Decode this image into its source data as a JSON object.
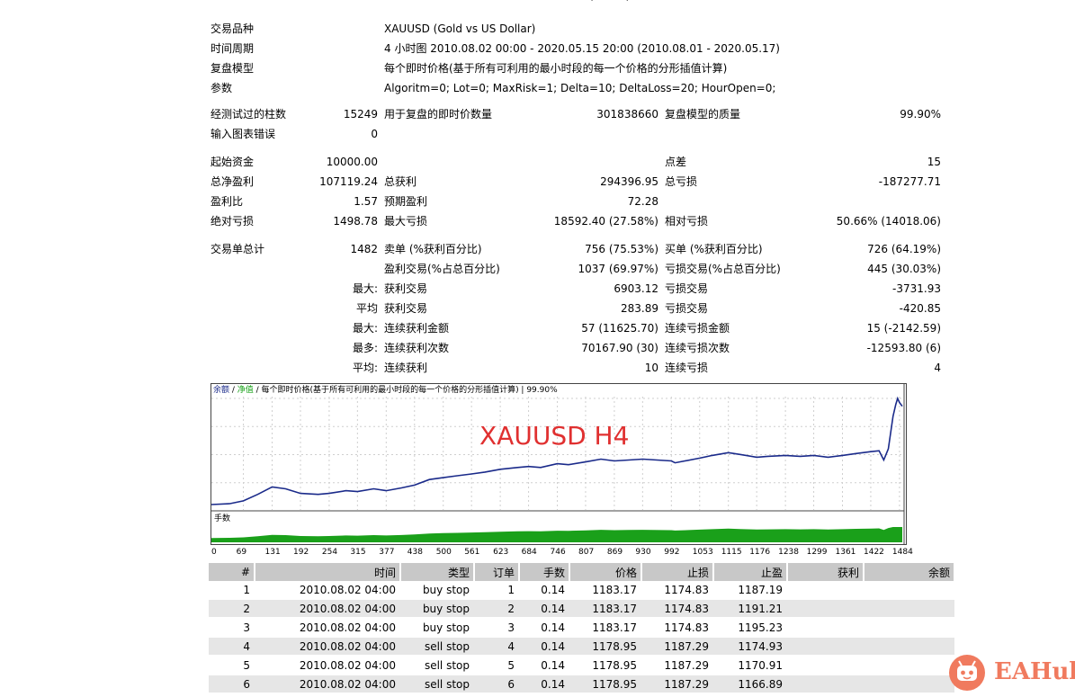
{
  "header_tail": "(………)",
  "info": [
    {
      "label": "交易品种",
      "value": "XAUUSD (Gold vs US Dollar)"
    },
    {
      "label": "时间周期",
      "value": "4 小时图 2010.08.02 00:00 - 2020.05.15 20:00 (2010.08.01 - 2020.05.17)"
    },
    {
      "label": "复盘模型",
      "value": "每个即时价格(基于所有可利用的最小时段的每一个价格的分形插值计算)"
    },
    {
      "label": "参数",
      "value": "Algoritm=0; Lot=0; MaxRisk=1; Delta=10; DeltaLoss=20; HourOpen=0;"
    }
  ],
  "stats": {
    "bars_label": "经测试过的柱数",
    "bars_value": "15249",
    "ticks_label": "用于复盘的即时价数量",
    "ticks_value": "301838660",
    "quality_label": "复盘模型的质量",
    "quality_value": "99.90%",
    "errors_label": "输入图表错误",
    "errors_value": "0",
    "deposit_label": "起始资金",
    "deposit_value": "10000.00",
    "spread_label": "点差",
    "spread_value": "15",
    "net_label": "总净盈利",
    "net_value": "107119.24",
    "gross_profit_label": "总获利",
    "gross_profit_value": "294396.95",
    "gross_loss_label": "总亏损",
    "gross_loss_value": "-187277.71",
    "pf_label": "盈利比",
    "pf_value": "1.57",
    "expected_label": "预期盈利",
    "expected_value": "72.28",
    "abs_dd_label": "绝对亏损",
    "abs_dd_value": "1498.78",
    "max_dd_label": "最大亏损",
    "max_dd_value": "18592.40 (27.58%)",
    "rel_dd_label": "相对亏损",
    "rel_dd_value": "50.66% (14018.06)",
    "total_trades_label": "交易单总计",
    "total_trades_value": "1482",
    "short_label": "卖单 (%获利百分比)",
    "short_value": "756 (75.53%)",
    "long_label": "买单 (%获利百分比)",
    "long_value": "726 (64.19%)",
    "profit_trades_label": "盈利交易(%占总百分比)",
    "profit_trades_value": "1037 (69.97%)",
    "loss_trades_label": "亏损交易(%占总百分比)",
    "loss_trades_value": "445 (30.03%)",
    "largest_prefix": "最大:",
    "largest_profit_label": "获利交易",
    "largest_profit_value": "6903.12",
    "largest_loss_label": "亏损交易",
    "largest_loss_value": "-3731.93",
    "average_prefix": "平均",
    "average_profit_label": "获利交易",
    "average_profit_value": "283.89",
    "average_loss_label": "亏损交易",
    "average_loss_value": "-420.85",
    "max_cons_prefix": "最大:",
    "max_cons_wins_label": "连续获利金额",
    "max_cons_wins_value": "57 (11625.70)",
    "max_cons_losses_label": "连续亏损金额",
    "max_cons_losses_value": "15 (-2142.59)",
    "maximal_prefix": "最多:",
    "maximal_wins_label": "连续获利次数",
    "maximal_wins_value": "70167.90 (30)",
    "maximal_losses_label": "连续亏损次数",
    "maximal_losses_value": "-12593.80 (6)",
    "avg_cons_prefix": "平均:",
    "avg_cons_wins_label": "连续获利",
    "avg_cons_wins_value": "10",
    "avg_cons_losses_label": "连续亏损",
    "avg_cons_losses_value": "4"
  },
  "chart": {
    "caption_balance": "余额",
    "caption_sep1": " / ",
    "caption_equity": "净值",
    "caption_rest": " / 每个即时价格(基于所有可利用的最小时段的每一个价格的分形插值计算) | 99.90%",
    "overlay_title": "XAUUSD H4",
    "volume_label": "手数",
    "balance_color": "#1a2a8a",
    "volume_color": "#1aa01a"
  },
  "chart_data": {
    "type": "line",
    "series": [
      {
        "name": "余额"
      }
    ],
    "x_ticks": [
      0,
      69,
      131,
      192,
      254,
      315,
      377,
      438,
      500,
      561,
      623,
      684,
      746,
      807,
      869,
      930,
      992,
      1053,
      1115,
      1176,
      1238,
      1299,
      1361,
      1422,
      1484
    ],
    "y_ticks": [
      124417,
      94122,
      63827,
      33533,
      3238
    ],
    "balance_points": [
      [
        0,
        10000
      ],
      [
        40,
        11000
      ],
      [
        69,
        14000
      ],
      [
        100,
        21000
      ],
      [
        131,
        29000
      ],
      [
        160,
        27000
      ],
      [
        192,
        22000
      ],
      [
        230,
        21000
      ],
      [
        254,
        22000
      ],
      [
        290,
        25000
      ],
      [
        315,
        24000
      ],
      [
        350,
        27000
      ],
      [
        377,
        25000
      ],
      [
        410,
        28000
      ],
      [
        438,
        31000
      ],
      [
        470,
        37000
      ],
      [
        500,
        39000
      ],
      [
        530,
        41000
      ],
      [
        561,
        43000
      ],
      [
        590,
        45000
      ],
      [
        623,
        48000
      ],
      [
        660,
        50000
      ],
      [
        684,
        51000
      ],
      [
        710,
        50000
      ],
      [
        746,
        54000
      ],
      [
        770,
        53000
      ],
      [
        807,
        56000
      ],
      [
        840,
        59000
      ],
      [
        869,
        57000
      ],
      [
        900,
        58000
      ],
      [
        930,
        59000
      ],
      [
        992,
        57000
      ],
      [
        1000,
        55000
      ],
      [
        1053,
        60000
      ],
      [
        1080,
        63000
      ],
      [
        1115,
        66000
      ],
      [
        1140,
        64000
      ],
      [
        1176,
        61000
      ],
      [
        1200,
        62000
      ],
      [
        1238,
        63000
      ],
      [
        1270,
        62000
      ],
      [
        1299,
        63000
      ],
      [
        1330,
        61000
      ],
      [
        1361,
        63000
      ],
      [
        1390,
        65000
      ],
      [
        1422,
        67000
      ],
      [
        1440,
        68000
      ],
      [
        1450,
        58000
      ],
      [
        1460,
        70000
      ],
      [
        1470,
        105000
      ],
      [
        1476,
        118000
      ],
      [
        1480,
        124417
      ],
      [
        1484,
        120000
      ],
      [
        1490,
        116000
      ]
    ],
    "x_range": [
      0,
      1490
    ],
    "y_range": [
      3238,
      124417
    ]
  },
  "orders": {
    "headers": [
      "#",
      "时间",
      "类型",
      "订单",
      "手数",
      "价格",
      "止损",
      "止盈",
      "获利",
      "余额"
    ],
    "rows": [
      [
        "1",
        "2010.08.02 04:00",
        "buy stop",
        "1",
        "0.14",
        "1183.17",
        "1174.83",
        "1187.19",
        "",
        ""
      ],
      [
        "2",
        "2010.08.02 04:00",
        "buy stop",
        "2",
        "0.14",
        "1183.17",
        "1174.83",
        "1191.21",
        "",
        ""
      ],
      [
        "3",
        "2010.08.02 04:00",
        "buy stop",
        "3",
        "0.14",
        "1183.17",
        "1174.83",
        "1195.23",
        "",
        ""
      ],
      [
        "4",
        "2010.08.02 04:00",
        "sell stop",
        "4",
        "0.14",
        "1178.95",
        "1187.29",
        "1174.93",
        "",
        ""
      ],
      [
        "5",
        "2010.08.02 04:00",
        "sell stop",
        "5",
        "0.14",
        "1178.95",
        "1187.29",
        "1170.91",
        "",
        ""
      ],
      [
        "6",
        "2010.08.02 04:00",
        "sell stop",
        "6",
        "0.14",
        "1178.95",
        "1187.29",
        "1166.89",
        "",
        ""
      ]
    ]
  },
  "logo": {
    "text": "EAHub",
    "icon": "robot-face-icon",
    "color": "#f07a5e"
  }
}
